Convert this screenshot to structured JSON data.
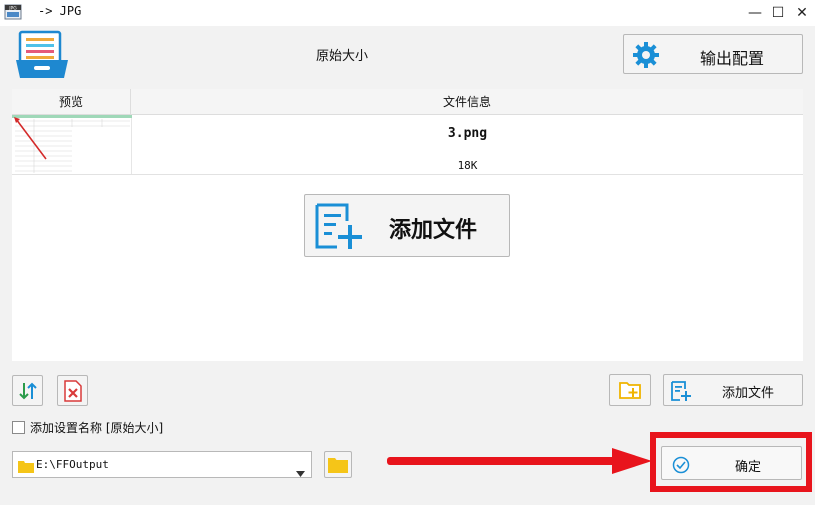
{
  "window": {
    "app_icon_text": "JPG",
    "title": "-> JPG",
    "controls": {
      "minimize": "—",
      "maximize": "☐",
      "close": "✕"
    }
  },
  "header": {
    "preset_name": "原始大小",
    "output_config_label": "输出配置"
  },
  "file_list": {
    "columns": [
      "预览",
      "文件信息"
    ],
    "rows": [
      {
        "name": "3.png",
        "size": "18K"
      }
    ]
  },
  "add_file_big_label": "添加文件",
  "toolbar": {
    "add_file_label": "添加文件"
  },
  "options": {
    "add_setting_name_label": "添加设置名称 [原始大小]",
    "add_setting_name_checked": false
  },
  "output": {
    "path": "E:\\FFOutput"
  },
  "confirm_label": "确定",
  "colors": {
    "accent_blue": "#1a8fd6",
    "folder_yellow": "#f5c518",
    "remove_red": "#d93a3a",
    "highlight_red": "#e8141c"
  }
}
